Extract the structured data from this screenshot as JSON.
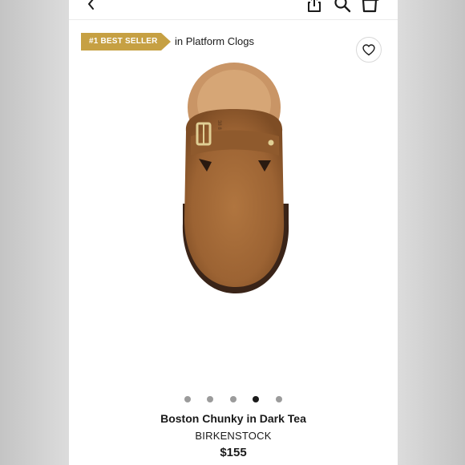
{
  "header": {
    "icons": [
      "back-icon",
      "share-icon",
      "search-icon",
      "shopping-bag-icon"
    ]
  },
  "badge": {
    "label": "#1 BEST SELLER",
    "color": "#c6a043"
  },
  "category": {
    "text": "in Platform Clogs"
  },
  "gallery": {
    "image_count": 5,
    "active_index": 3
  },
  "product": {
    "name": "Boston Chunky in Dark Tea",
    "brand": "BIRKENSTOCK",
    "price": "$155"
  },
  "colors": {
    "text": "#1a1a1a",
    "suede": "#a36a3a",
    "inactive_dot": "#9b9b9b"
  }
}
